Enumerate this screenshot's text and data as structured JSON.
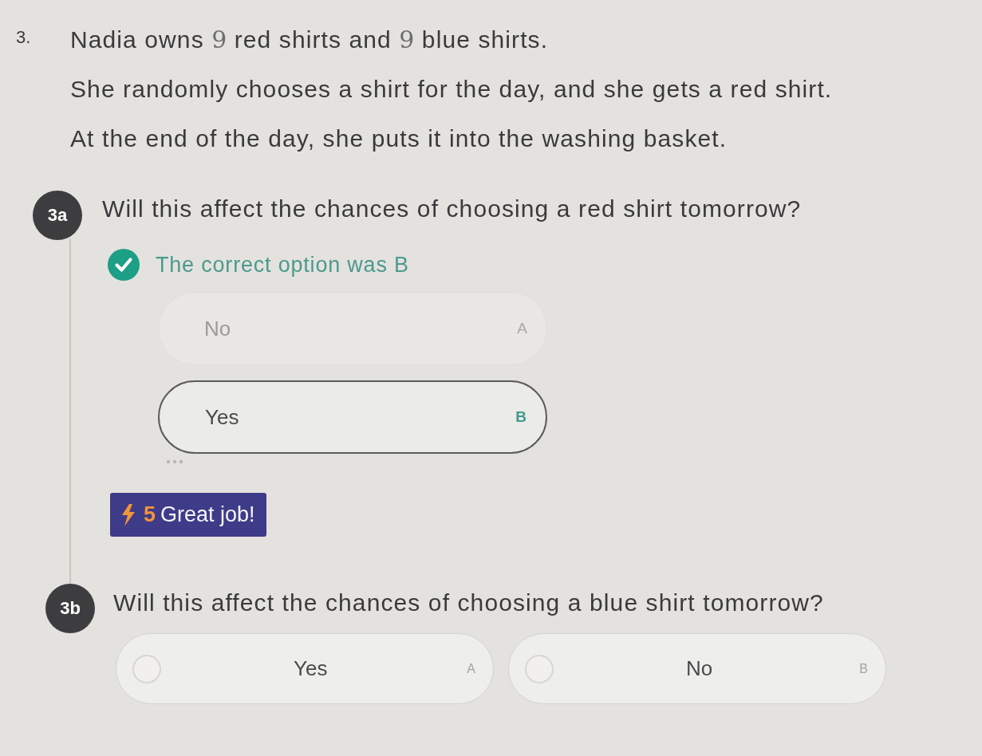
{
  "question": {
    "number": "3.",
    "paragraphs": [
      [
        {
          "kind": "text",
          "text": "Nadia owns "
        },
        {
          "kind": "math",
          "text": "9"
        },
        {
          "kind": "text",
          "text": " red shirts and "
        },
        {
          "kind": "math",
          "text": "9"
        },
        {
          "kind": "text",
          "text": " blue shirts."
        }
      ],
      [
        {
          "kind": "text",
          "text": "She randomly chooses a shirt for the day, and she gets a red shirt."
        }
      ],
      [
        {
          "kind": "text",
          "text": "At the end of the day, she puts it into the washing basket."
        }
      ]
    ]
  },
  "parts": [
    {
      "label": "3a",
      "kind": "answered",
      "prompt": "Will this affect the chances of choosing a red shirt tomorrow?",
      "result": "The correct option was B",
      "options": [
        {
          "text": "No",
          "letter": "A",
          "selected": false
        },
        {
          "text": "Yes",
          "letter": "B",
          "selected": true
        }
      ],
      "reward": {
        "points": "5",
        "message": "Great job!"
      }
    },
    {
      "label": "3b",
      "kind": "open",
      "prompt": "Will this affect the chances of choosing a blue shirt tomorrow?",
      "options": [
        {
          "text": "Yes",
          "letter": "A",
          "selected": false
        },
        {
          "text": "No",
          "letter": "B",
          "selected": false
        }
      ]
    }
  ]
}
